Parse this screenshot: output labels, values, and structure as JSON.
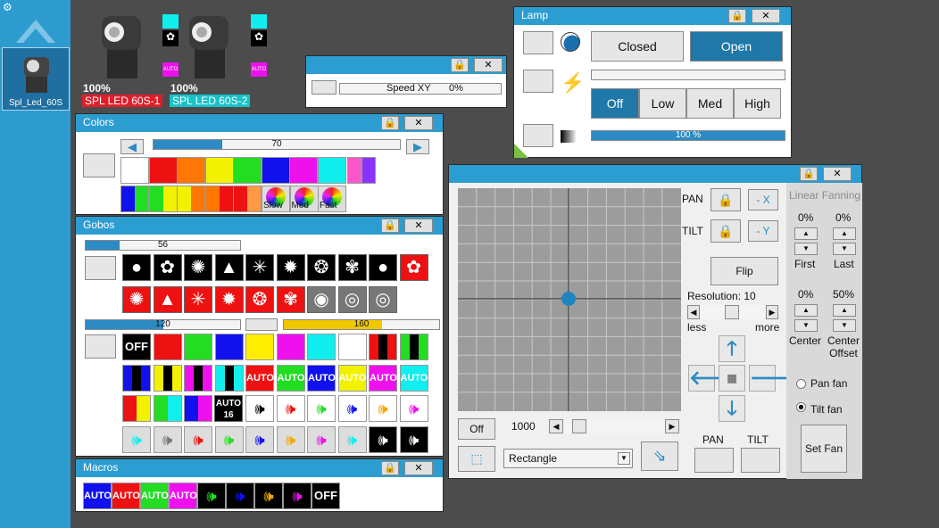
{
  "sidebar": {
    "fixture_label": "Spl_Led_60S"
  },
  "fixtures": [
    {
      "intensity": "100%",
      "name": "SPL LED 60S-1",
      "name_color": "#e01e2a",
      "auto_label": "AUTO"
    },
    {
      "intensity": "100%",
      "name": "SPL LED 60S-2",
      "name_color": "#17c2c7",
      "auto_label": "AUTO"
    }
  ],
  "speed_window": {
    "label": "Speed XY",
    "value": "0%"
  },
  "lamp": {
    "title": "Lamp",
    "closed": "Closed",
    "open": "Open",
    "off": "Off",
    "low": "Low",
    "med": "Med",
    "high": "High",
    "dimmer": "100 %",
    "dimmer_value": 1.0
  },
  "colors": {
    "title": "Colors",
    "slider_value": "70",
    "slider_level": 0.21,
    "row1": [
      "#ffffff",
      "#ee1111",
      "#ff7700",
      "#f2f200",
      "#22dd22",
      "#1111ee",
      "#ee11ee",
      "#11eeee"
    ],
    "row1_extra": [
      "#ff55cc",
      "#8833ff"
    ],
    "speed_labels": [
      "Slow",
      "Med",
      "Fast"
    ]
  },
  "gobos": {
    "title": "Gobos",
    "slider_value": "56",
    "slider_level": 0.22,
    "slider2_value": "120",
    "slider2_level": 0.5,
    "slider3_value": "160",
    "slider3_level": 0.63,
    "row3_colors": [
      "OFF",
      "#ee1111",
      "#22dd22",
      "#1111ee",
      "#ffee00",
      "#ee11ee",
      "#11eeee",
      "#ffffff"
    ],
    "auto": "AUTO",
    "auto16": "AUTO 16",
    "off": "OFF"
  },
  "macros": {
    "title": "Macros",
    "labels": [
      "AUTO",
      "AUTO",
      "AUTO",
      "AUTO",
      "OFF"
    ],
    "colors": [
      "#1111ee",
      "#ee1111",
      "#22dd22",
      "#ee11ee"
    ]
  },
  "pantilt": {
    "pan": "PAN",
    "tilt": "TILT",
    "minus_x": "- X",
    "minus_y": "- Y",
    "flip": "Flip",
    "resolution": "Resolution: 10",
    "less": "less",
    "more": "more",
    "off": "Off",
    "speed": "1000",
    "shape": "Rectangle",
    "pan_btn": "PAN",
    "tilt_btn": "TILT",
    "linear_fanning": "Linear Fanning",
    "first_pct": "0%",
    "last_pct": "0%",
    "first": "First",
    "last": "Last",
    "center_pct": "0%",
    "offset_pct": "50%",
    "center": "Center",
    "center_offset": "Center Offset",
    "pan_fan": "Pan fan",
    "tilt_fan": "Tilt fan",
    "set_fan": "Set Fan"
  }
}
